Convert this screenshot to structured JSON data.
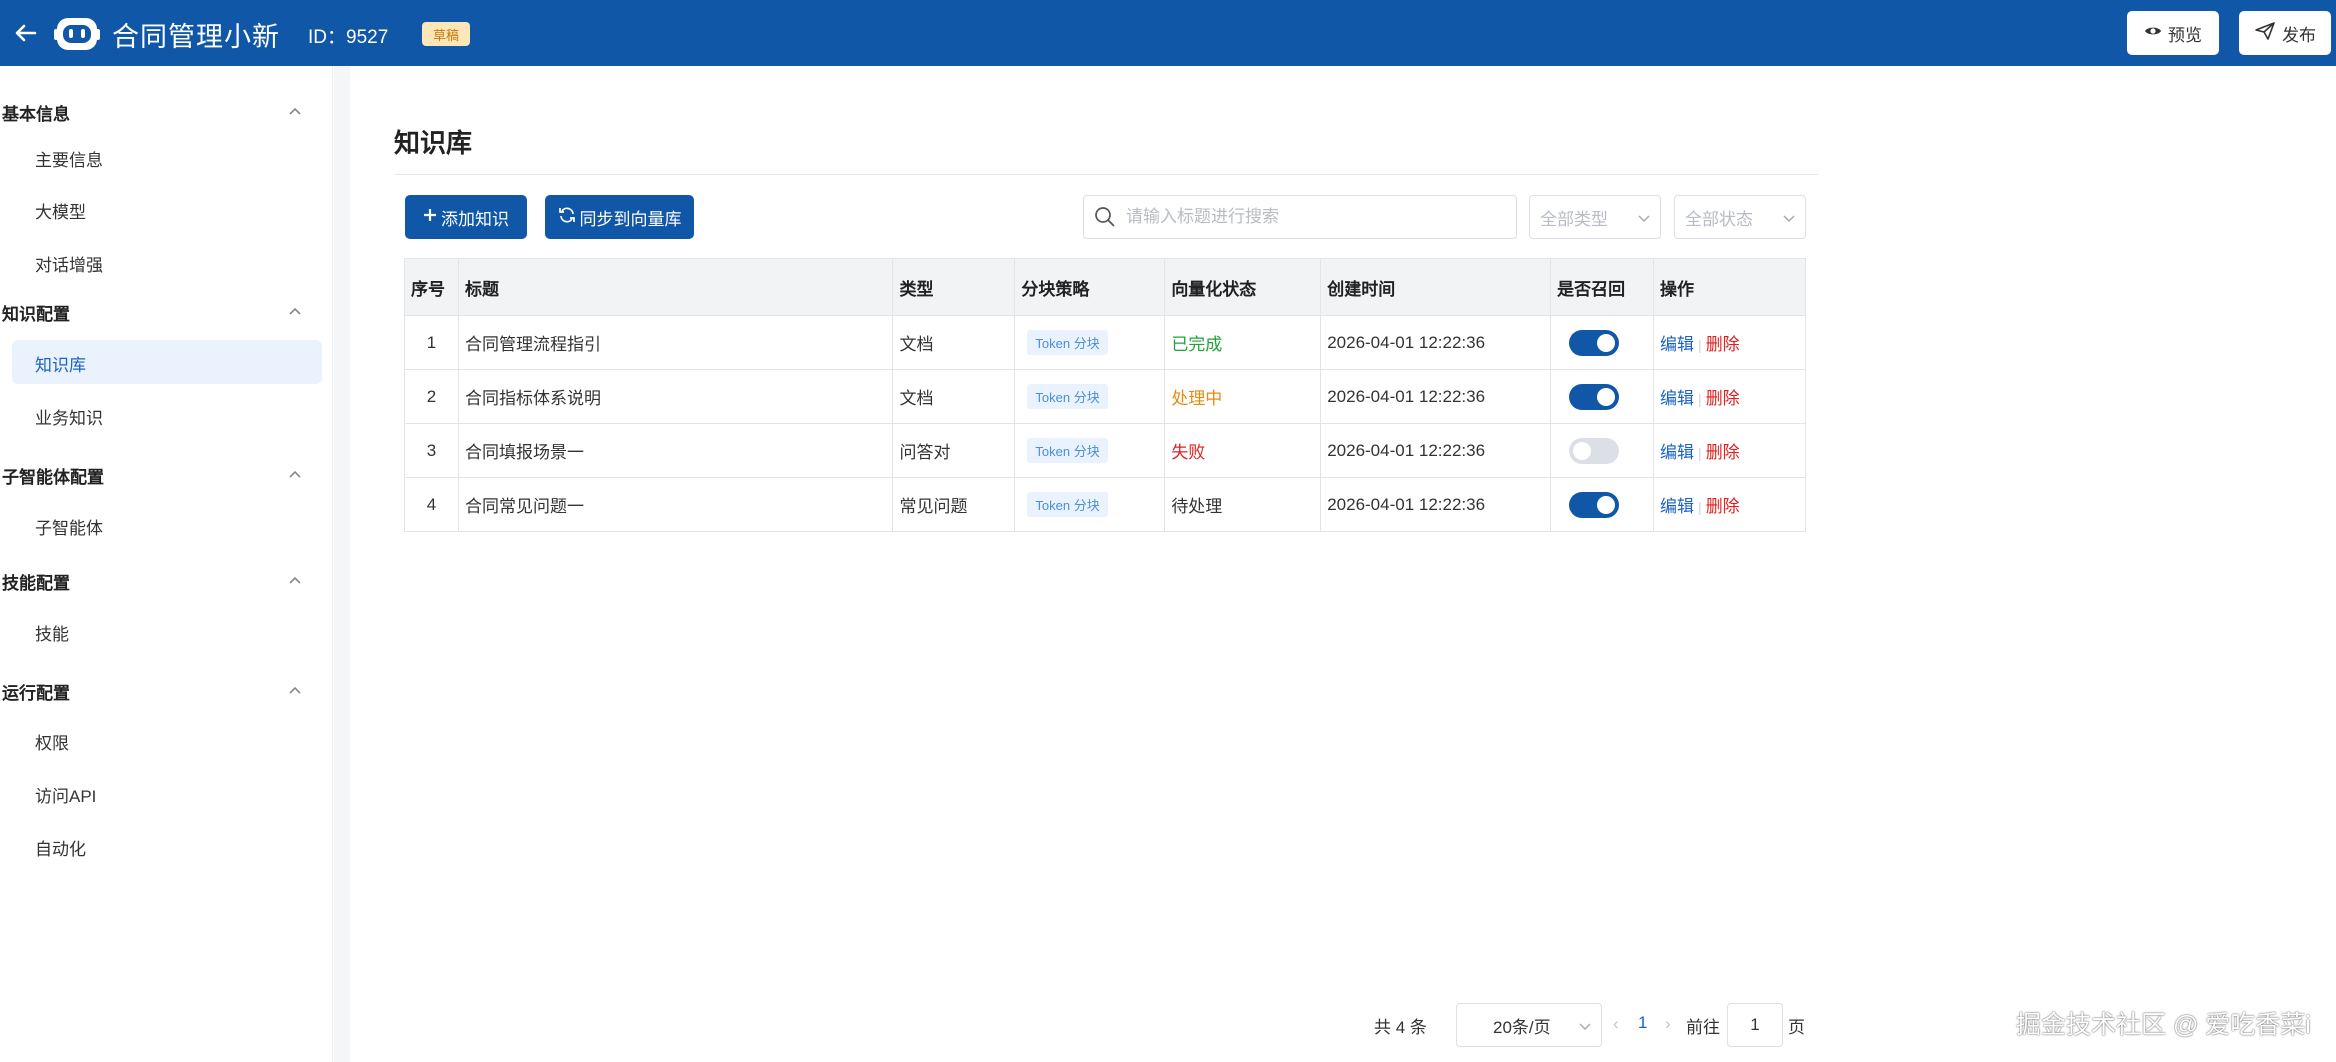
{
  "header": {
    "app_title": "合同管理小新",
    "id_text": "ID：9527",
    "badge": "草稿",
    "preview_label": "预览",
    "publish_label": "发布"
  },
  "sidebar": {
    "groups": [
      {
        "title": "基本信息",
        "items": [
          "主要信息",
          "大模型",
          "对话增强"
        ]
      },
      {
        "title": "知识配置",
        "items": [
          "知识库",
          "业务知识"
        ]
      },
      {
        "title": "子智能体配置",
        "items": [
          "子智能体"
        ]
      },
      {
        "title": "技能配置",
        "items": [
          "技能"
        ]
      },
      {
        "title": "运行配置",
        "items": [
          "权限",
          "访问API",
          "自动化"
        ]
      }
    ],
    "active_item": "知识库"
  },
  "main": {
    "page_title": "知识库",
    "add_button": "添加知识",
    "sync_button": "同步到向量库",
    "search_placeholder": "请输入标题进行搜索",
    "type_filter_placeholder": "全部类型",
    "status_filter_placeholder": "全部状态"
  },
  "table": {
    "columns": [
      "序号",
      "标题",
      "类型",
      "分块策略",
      "向量化状态",
      "创建时间",
      "是否召回",
      "操作"
    ],
    "rows": [
      {
        "index": "1",
        "title": "合同管理流程指引",
        "type": "文档",
        "chunk": "Token 分块",
        "status": "已完成",
        "status_kind": "done",
        "created": "2026-04-01 12:22:36",
        "recall": true,
        "edit": "编辑",
        "delete": "删除"
      },
      {
        "index": "2",
        "title": "合同指标体系说明",
        "type": "文档",
        "chunk": "Token 分块",
        "status": "处理中",
        "status_kind": "processing",
        "created": "2026-04-01 12:22:36",
        "recall": true,
        "edit": "编辑",
        "delete": "删除"
      },
      {
        "index": "3",
        "title": "合同填报场景一",
        "type": "问答对",
        "chunk": "Token 分块",
        "status": "失败",
        "status_kind": "failed",
        "created": "2026-04-01 12:22:36",
        "recall": false,
        "edit": "编辑",
        "delete": "删除"
      },
      {
        "index": "4",
        "title": "合同常见问题一",
        "type": "常见问题",
        "chunk": "Token 分块",
        "status": "待处理",
        "status_kind": "pending",
        "created": "2026-04-01 12:22:36",
        "recall": true,
        "edit": "编辑",
        "delete": "删除"
      }
    ]
  },
  "pagination": {
    "total_text": "共 4 条",
    "page_size": "20条/页",
    "current_page": "1",
    "goto_label": "前往",
    "goto_value": "1",
    "page_unit": "页"
  },
  "watermark": "掘金技术社区 @ 爱吃香菜i",
  "colors": {
    "brand": "#1057a8",
    "done": "#1fa33a",
    "processing": "#e88a10",
    "failed": "#e02020",
    "link": "#1a63c3"
  }
}
